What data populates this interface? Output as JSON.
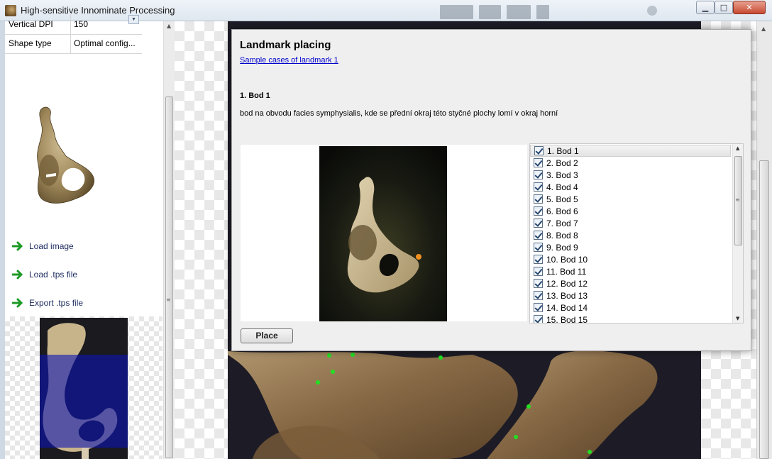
{
  "window": {
    "title": "High-sensitive Innominate Processing",
    "minimize_glyph": "▁",
    "maximize_glyph": "□",
    "close_glyph": "✕"
  },
  "properties": [
    {
      "label": "Vertical DPI",
      "value": "150"
    },
    {
      "label": "Shape type",
      "value": "Optimal config..."
    }
  ],
  "actions": [
    {
      "label": "Load image",
      "icon": "green-arrow-right-icon"
    },
    {
      "label": "Load .tps file",
      "icon": "green-arrow-right-icon"
    },
    {
      "label": "Export .tps file",
      "icon": "green-arrow-right-icon"
    }
  ],
  "dialog": {
    "title": "Landmark placing",
    "link": "Sample cases of landmark 1",
    "heading": "1. Bod 1",
    "description": "bod na obvodu facies symphysialis, kde se přední okraj této styčné plochy lomí v okraj horní",
    "place_button": "Place",
    "landmarks": [
      "1.  Bod 1",
      "2.  Bod 2",
      "3.  Bod 3",
      "4.  Bod 4",
      "5.  Bod 5",
      "6.  Bod 6",
      "7.  Bod 7",
      "8.  Bod 8",
      "9.  Bod 9",
      "10.  Bod 10",
      "11.  Bod 11",
      "12.  Bod 12",
      "13.  Bod 13",
      "14.  Bod 14",
      "15.  Bod 15"
    ],
    "checked": true
  },
  "colors": {
    "bone": "#c9b58a",
    "landmark_marker": "#f0901e",
    "placed_landmark": "#22e022",
    "selection_overlay": "#0b14b4"
  }
}
